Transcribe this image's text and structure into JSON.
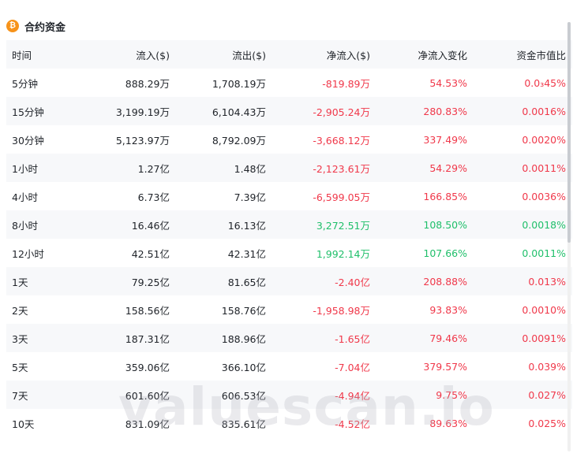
{
  "panel": {
    "title": "合约资金",
    "coin_icon": "bitcoin-icon",
    "coin_glyph": "₿"
  },
  "table": {
    "headers": {
      "period": "时间",
      "inflow": "流入($)",
      "outflow": "流出($)",
      "net_inflow": "净流入($)",
      "net_change": "净流入变化",
      "mcap_ratio": "资金市值比"
    },
    "rows": [
      {
        "period": "5分钟",
        "inflow": "888.29万",
        "outflow": "1,708.19万",
        "net_inflow": "-819.89万",
        "net_change": "54.53%",
        "mcap_ratio": "0.0₃45%"
      },
      {
        "period": "15分钟",
        "inflow": "3,199.19万",
        "outflow": "6,104.43万",
        "net_inflow": "-2,905.24万",
        "net_change": "280.83%",
        "mcap_ratio": "0.0016%"
      },
      {
        "period": "30分钟",
        "inflow": "5,123.97万",
        "outflow": "8,792.09万",
        "net_inflow": "-3,668.12万",
        "net_change": "337.49%",
        "mcap_ratio": "0.0020%"
      },
      {
        "period": "1小时",
        "inflow": "1.27亿",
        "outflow": "1.48亿",
        "net_inflow": "-2,123.61万",
        "net_change": "54.29%",
        "mcap_ratio": "0.0011%"
      },
      {
        "period": "4小时",
        "inflow": "6.73亿",
        "outflow": "7.39亿",
        "net_inflow": "-6,599.05万",
        "net_change": "166.85%",
        "mcap_ratio": "0.0036%"
      },
      {
        "period": "8小时",
        "inflow": "16.46亿",
        "outflow": "16.13亿",
        "net_inflow": "3,272.51万",
        "net_change": "108.50%",
        "mcap_ratio": "0.0018%"
      },
      {
        "period": "12小时",
        "inflow": "42.51亿",
        "outflow": "42.31亿",
        "net_inflow": "1,992.14万",
        "net_change": "107.66%",
        "mcap_ratio": "0.0011%"
      },
      {
        "period": "1天",
        "inflow": "79.25亿",
        "outflow": "81.65亿",
        "net_inflow": "-2.40亿",
        "net_change": "208.88%",
        "mcap_ratio": "0.013%"
      },
      {
        "period": "2天",
        "inflow": "158.56亿",
        "outflow": "158.76亿",
        "net_inflow": "-1,958.98万",
        "net_change": "93.83%",
        "mcap_ratio": "0.0010%"
      },
      {
        "period": "3天",
        "inflow": "187.31亿",
        "outflow": "188.96亿",
        "net_inflow": "-1.65亿",
        "net_change": "79.46%",
        "mcap_ratio": "0.0091%"
      },
      {
        "period": "5天",
        "inflow": "359.06亿",
        "outflow": "366.10亿",
        "net_inflow": "-7.04亿",
        "net_change": "379.57%",
        "mcap_ratio": "0.039%"
      },
      {
        "period": "7天",
        "inflow": "601.60亿",
        "outflow": "606.53亿",
        "net_inflow": "-4.94亿",
        "net_change": "9.75%",
        "mcap_ratio": "0.027%"
      },
      {
        "period": "10天",
        "inflow": "831.09亿",
        "outflow": "835.61亿",
        "net_inflow": "-4.52亿",
        "net_change": "89.63%",
        "mcap_ratio": "0.025%"
      }
    ]
  },
  "colors": {
    "positive": "#1fbf6a",
    "negative": "#f0384a",
    "row_stripe": "#f7f8fa",
    "coin": "#f7931a"
  },
  "watermark": "valuescan.io"
}
